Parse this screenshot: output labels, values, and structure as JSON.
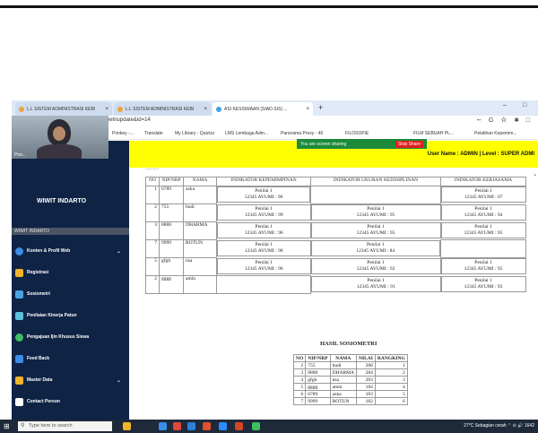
{
  "browser": {
    "tabs": [
      {
        "label": "L.L SISTEM ADMINISTRASI KEBI"
      },
      {
        "label": "L.L SISTEM ADMINISTRASI KEBI"
      },
      {
        "label": "ASI KESISWAAN (SIAD-SIS) ..."
      }
    ],
    "new_tab": "+",
    "window_controls": [
      "–",
      "□"
    ],
    "url": "d-sis.com/admin/index.php?hal=sosiometriupdate&id=14",
    "url_actions": "⭪ G ☆ ✱ □",
    "bookmarks": [
      "Ponkey -...",
      "Translate",
      "My Library - Quizizz",
      "LMS Lembaga Adm...",
      "Panorama Proxy - 40",
      "FILOSOFIE",
      "FILM SEBUAH PL...",
      "Pelatihan Kepemim..."
    ],
    "share_text": "You are screen sharing",
    "stop_share": "Stop Share"
  },
  "header": {
    "user_info": "User Name : ADMIN | Level : SUPER ADMI"
  },
  "sidebar": {
    "webcam_label": "Poo...",
    "user_name": "WIWIT INDARTO",
    "user_sub": "WIWIT INDARTO",
    "items": [
      {
        "label": "Konten & Profil Web",
        "icon": "globe-icon",
        "color": "#3a8ee6",
        "chevron": "⌄"
      },
      {
        "label": "Registrasi",
        "icon": "user-icon",
        "color": "#f3b32a",
        "chevron": ""
      },
      {
        "label": "Sosiometri",
        "icon": "chart-icon",
        "color": "#4aa3df",
        "chevron": ""
      },
      {
        "label": "Penilaian Kinerja Patun",
        "icon": "document-icon",
        "color": "#5bc0de",
        "chevron": ""
      },
      {
        "label": "Pengajuan Ijin Khusus Siswa",
        "icon": "check-icon",
        "color": "#3fbf5f",
        "chevron": ""
      },
      {
        "label": "Feed Back",
        "icon": "reply-icon",
        "color": "#3a8ee6",
        "chevron": ""
      },
      {
        "label": "Master Data",
        "icon": "folder-icon",
        "color": "#f3b32a",
        "chevron": "⌄"
      },
      {
        "label": "Contact Person",
        "icon": "pen-icon",
        "color": "#ffffff",
        "chevron": ""
      }
    ]
  },
  "content": {
    "cut_heading": "...........",
    "scroll_up": "▴",
    "table_headers": [
      "NO",
      "NIP/NRP",
      "NAMA",
      "INDIKATOR KEPEMIMPINAN",
      "INDIKATOR UKURAN KEDISIPLINAN",
      "INDIKATOR KERJASAMA"
    ],
    "rows": [
      {
        "no": "1",
        "nip": "6789",
        "nama": "azka",
        "kep": [
          "Penilai 1",
          "12345 AYUMI : 96"
        ],
        "dis": [],
        "ker": [
          "Penilai 1",
          "12345 AYUMI : 87"
        ]
      },
      {
        "no": "2",
        "nip": "755",
        "nama": "budi",
        "kep": [
          "Penilai 1",
          "12345 AYUMI : 99"
        ],
        "dis": [
          "Penilai 1",
          "12345 AYUMI : 95"
        ],
        "ker": [
          "Penilai 1",
          "12345 AYUMI : 94"
        ]
      },
      {
        "no": "3",
        "nip": "8888",
        "nama": "DHARMA",
        "kep": [
          "Penilai 1",
          "12345 AYUMI : 96"
        ],
        "dis": [
          "Penilai 1",
          "12345 AYUMI : 95"
        ],
        "ker": [
          "Penilai 1",
          "12345 AYUMI : 95"
        ]
      },
      {
        "no": "7",
        "nip": "9999",
        "nama": "ROTUN",
        "kep": [
          "Penilai 1",
          "12345 AYUMI : 98"
        ],
        "dis": [
          "Penilai 1",
          "12345 AYUMI : 84"
        ],
        "ker": []
      },
      {
        "no": "5",
        "nip": "gfgh",
        "nama": "nsa",
        "kep": [
          "Penilai 1",
          "12345 AYUMI : 96"
        ],
        "dis": [
          "Penilai 1",
          "12345 AYUMI : 92"
        ],
        "ker": [
          "Penilai 1",
          "12345 AYUMI : 95"
        ]
      },
      {
        "no": "2",
        "nip": "gggg",
        "nama": "amin",
        "kep": [],
        "dis": [
          "Penilai 1",
          "12345 AYUMI : 91"
        ],
        "ker": [
          "Penilai 1",
          "12345 AYUMI : 93"
        ]
      }
    ],
    "hasil_title": "HASIL SOSIOMETRI",
    "hasil_headers": [
      "NO",
      "NIP/NRP",
      "NAMA",
      "NILAI",
      "RANGKING"
    ],
    "hasil_rows": [
      [
        "2",
        "755",
        "budi",
        "288",
        "1"
      ],
      [
        "3",
        "8888",
        "DHARMA",
        "284",
        "2"
      ],
      [
        "4",
        "gfgh",
        "nsa",
        "283",
        "3"
      ],
      [
        "5",
        "gggg",
        "amin",
        "184",
        "4"
      ],
      [
        "6",
        "6789",
        "azka",
        "183",
        "5"
      ],
      [
        "7",
        "9999",
        "ROTUN",
        "182",
        "6"
      ]
    ]
  },
  "taskbar": {
    "search_placeholder": "Type here to search",
    "tray": "27°C  Sebagian cerah   ⌃  ⊙  🔊  1642"
  }
}
